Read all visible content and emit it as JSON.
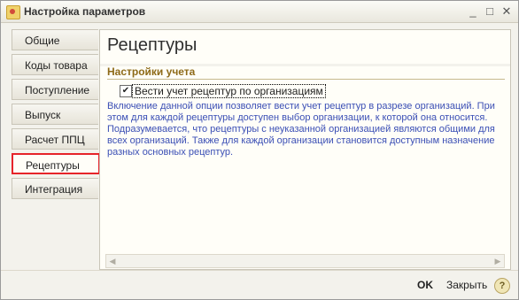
{
  "window": {
    "title": "Настройка параметров",
    "buttons": {
      "minimize": "_",
      "maximize": "□",
      "close": "✕"
    }
  },
  "tabs": [
    {
      "label": "Общие"
    },
    {
      "label": "Коды товара"
    },
    {
      "label": "Поступление"
    },
    {
      "label": "Выпуск"
    },
    {
      "label": "Расчет ППЦ"
    },
    {
      "label": "Рецептуры",
      "selected": true
    },
    {
      "label": "Интеграция"
    }
  ],
  "panel": {
    "heading": "Рецептуры",
    "section": "Настройки учета",
    "checkbox": {
      "label": "Вести учет рецептур по организациям",
      "checked": true
    },
    "description": "Включение данной опции позволяет вести учет рецептур в разрезе организаций. При этом для каждой рецептуры доступен выбор организации, к которой она относится. Подразумевается, что рецептуры с неуказанной организацией являются общими для всех организаций. Также для каждой организации становится доступным назначение разных основных рецептур."
  },
  "footer": {
    "ok": "OK",
    "close": "Закрыть",
    "help": "?"
  },
  "colors": {
    "accent": "#e6242a",
    "description_text": "#3b4fb5",
    "section_title": "#8e6a18"
  }
}
